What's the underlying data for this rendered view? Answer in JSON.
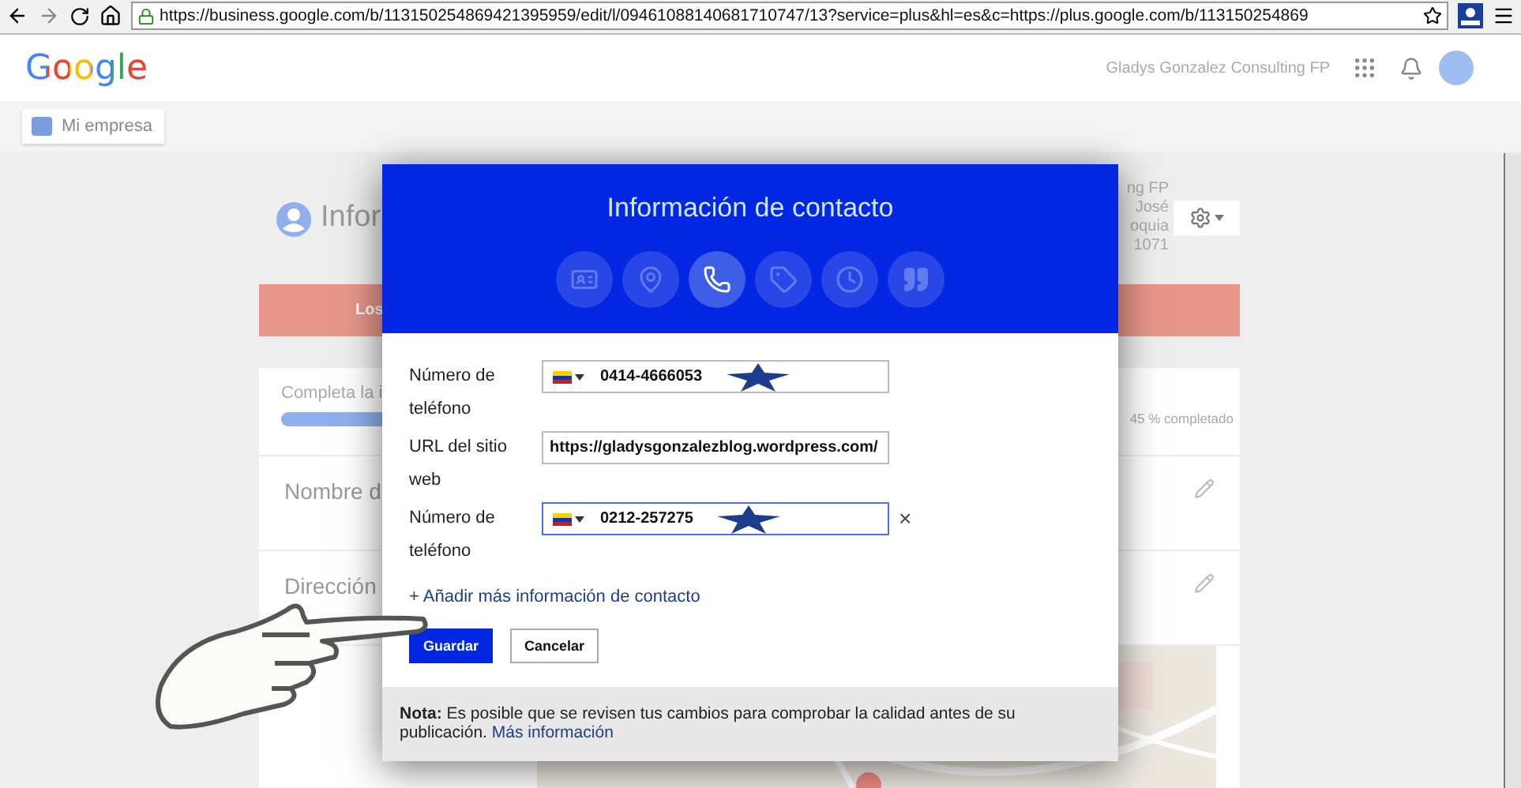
{
  "browser": {
    "url": "https://business.google.com/b/113150254869421395959/edit/l/09461088140681710747/13?service=plus&hl=es&c=https://plus.google.com/b/113150254869"
  },
  "header": {
    "logo": "Google",
    "account": "Gladys Gonzalez Consulting FP"
  },
  "subnav": {
    "button": "Mi empresa"
  },
  "profile": {
    "title": "Infor",
    "address_lines": [
      "ng FP",
      "José",
      "oquia",
      "1071"
    ],
    "banner": "Los",
    "progress": {
      "label": "Completa la i",
      "level": 0.45,
      "reading": "45 % completado"
    },
    "rows": [
      "Nombre d",
      "Dirección"
    ],
    "map": {
      "kind": "picture"
    }
  },
  "dialog": {
    "title": "Información de contacto",
    "tabs": [
      {
        "kind": "card",
        "selected": false
      },
      {
        "kind": "place",
        "selected": false
      },
      {
        "kind": "phone",
        "selected": true
      },
      {
        "kind": "tag",
        "selected": false
      },
      {
        "kind": "clock",
        "selected": false
      },
      {
        "kind": "quote",
        "selected": false
      }
    ],
    "fields": [
      {
        "kind": "phone",
        "label": "Número de teléfono",
        "value": "0414-4666053",
        "focused": false
      },
      {
        "kind": "text",
        "label": "URL del sitio web",
        "value": "https://gladysgonzalezblog.wordpress.com/",
        "focused": false
      },
      {
        "kind": "phone",
        "label": "Número de teléfono",
        "value": "0212-257275",
        "focused": true,
        "remove": "×"
      }
    ],
    "add_link": "+ Añadir más información de contacto",
    "buttons": [
      {
        "label": "Guardar",
        "primary": true
      },
      {
        "label": "Cancelar",
        "primary": false
      }
    ],
    "note": {
      "text": "**Nota:** Es posible que se revisen tus cambios para comprobar la calidad antes de su publicación.",
      "link": "Más información"
    }
  }
}
